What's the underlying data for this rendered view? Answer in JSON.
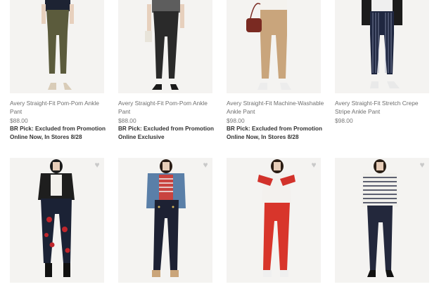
{
  "products": [
    {
      "title": "Avery Straight-Fit Pom-Pom Ankle Pant",
      "price": "$88.00",
      "badge": "BR Pick: Excluded from Promotion",
      "note": "Online Now, In Stores 8/28",
      "image": "model-olive-pant-image"
    },
    {
      "title": "Avery Straight-Fit Pom-Pom Ankle Pant",
      "price": "$88.00",
      "badge": "BR Pick: Excluded from Promotion",
      "note": "Online Exclusive",
      "image": "model-black-pant-image"
    },
    {
      "title": "Avery Straight-Fit Machine-Washable Ankle Pant",
      "price": "$98.00",
      "badge": "BR Pick: Excluded from Promotion",
      "note": "Online Now, In Stores 8/28",
      "image": "model-camel-pant-image"
    },
    {
      "title": "Avery Straight-Fit Stretch Crepe Stripe Ankle Pant",
      "price": "$98.00",
      "badge": "",
      "note": "",
      "image": "model-navy-stripe-pant-image"
    },
    {
      "image": "model-floral-pant-image"
    },
    {
      "image": "model-navy-sailor-pant-image"
    },
    {
      "image": "model-red-pant-image"
    },
    {
      "image": "model-navy-pant-image"
    }
  ],
  "icons": {
    "favorite": "heart-icon"
  }
}
